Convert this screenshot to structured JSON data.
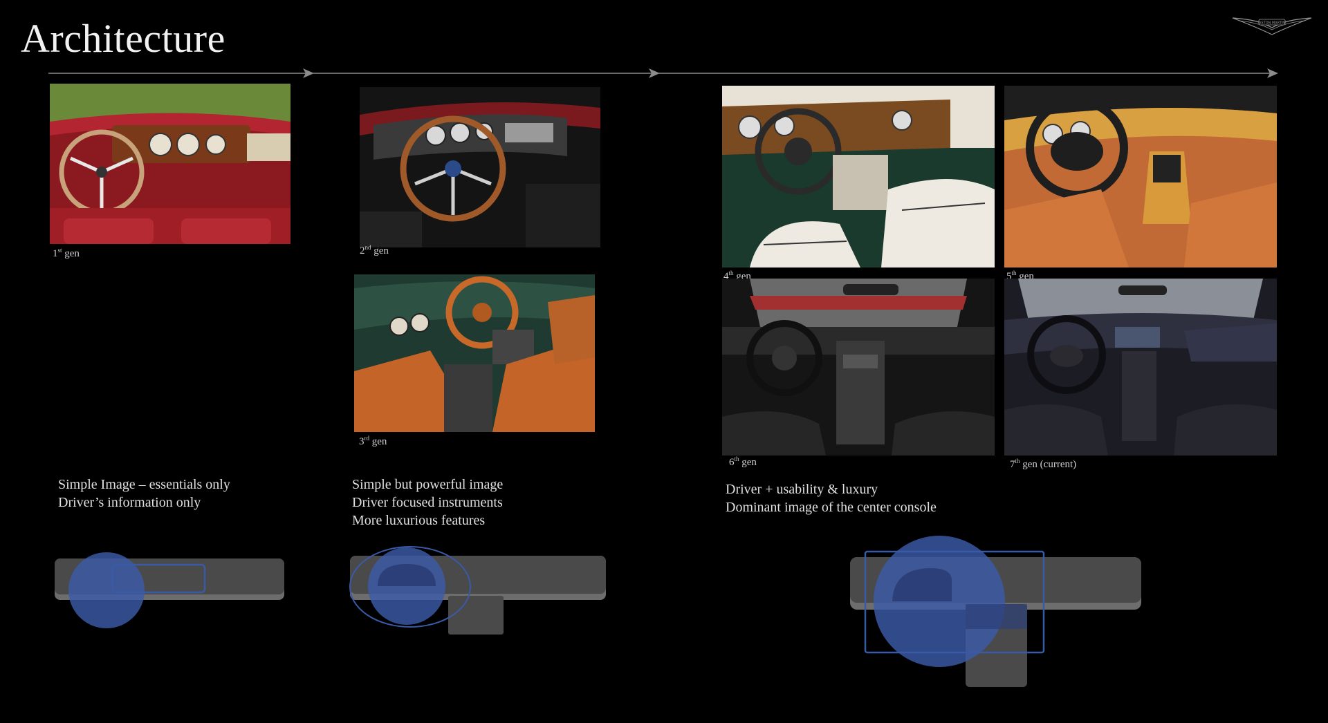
{
  "slide": {
    "title": "Architecture",
    "brand": "ASTON MARTIN"
  },
  "generations": [
    {
      "ordinal": "1",
      "suffix": "st",
      "label": "gen"
    },
    {
      "ordinal": "2",
      "suffix": "nd",
      "label": "gen"
    },
    {
      "ordinal": "3",
      "suffix": "rd",
      "label": "gen"
    },
    {
      "ordinal": "4",
      "suffix": "th",
      "label": "gen"
    },
    {
      "ordinal": "5",
      "suffix": "th",
      "label": "gen"
    },
    {
      "ordinal": "6",
      "suffix": "th",
      "label": "gen"
    },
    {
      "ordinal": "7",
      "suffix": "th",
      "label": "gen (current)"
    }
  ],
  "descriptions": [
    {
      "lines": [
        "Simple Image – essentials only",
        "Driver’s information only"
      ]
    },
    {
      "lines": [
        "Simple but powerful image",
        "Driver focused instruments",
        "More luxurious features"
      ]
    },
    {
      "lines": [
        "Driver + usability & luxury",
        "Dominant image of the center console"
      ]
    }
  ],
  "colors": {
    "background": "#000000",
    "dash_gray": "#4a4a4a",
    "dash_shadow": "#6d6d6d",
    "highlight_blue": "#3a5aa8",
    "arrow_gray": "#8c8c8c"
  }
}
